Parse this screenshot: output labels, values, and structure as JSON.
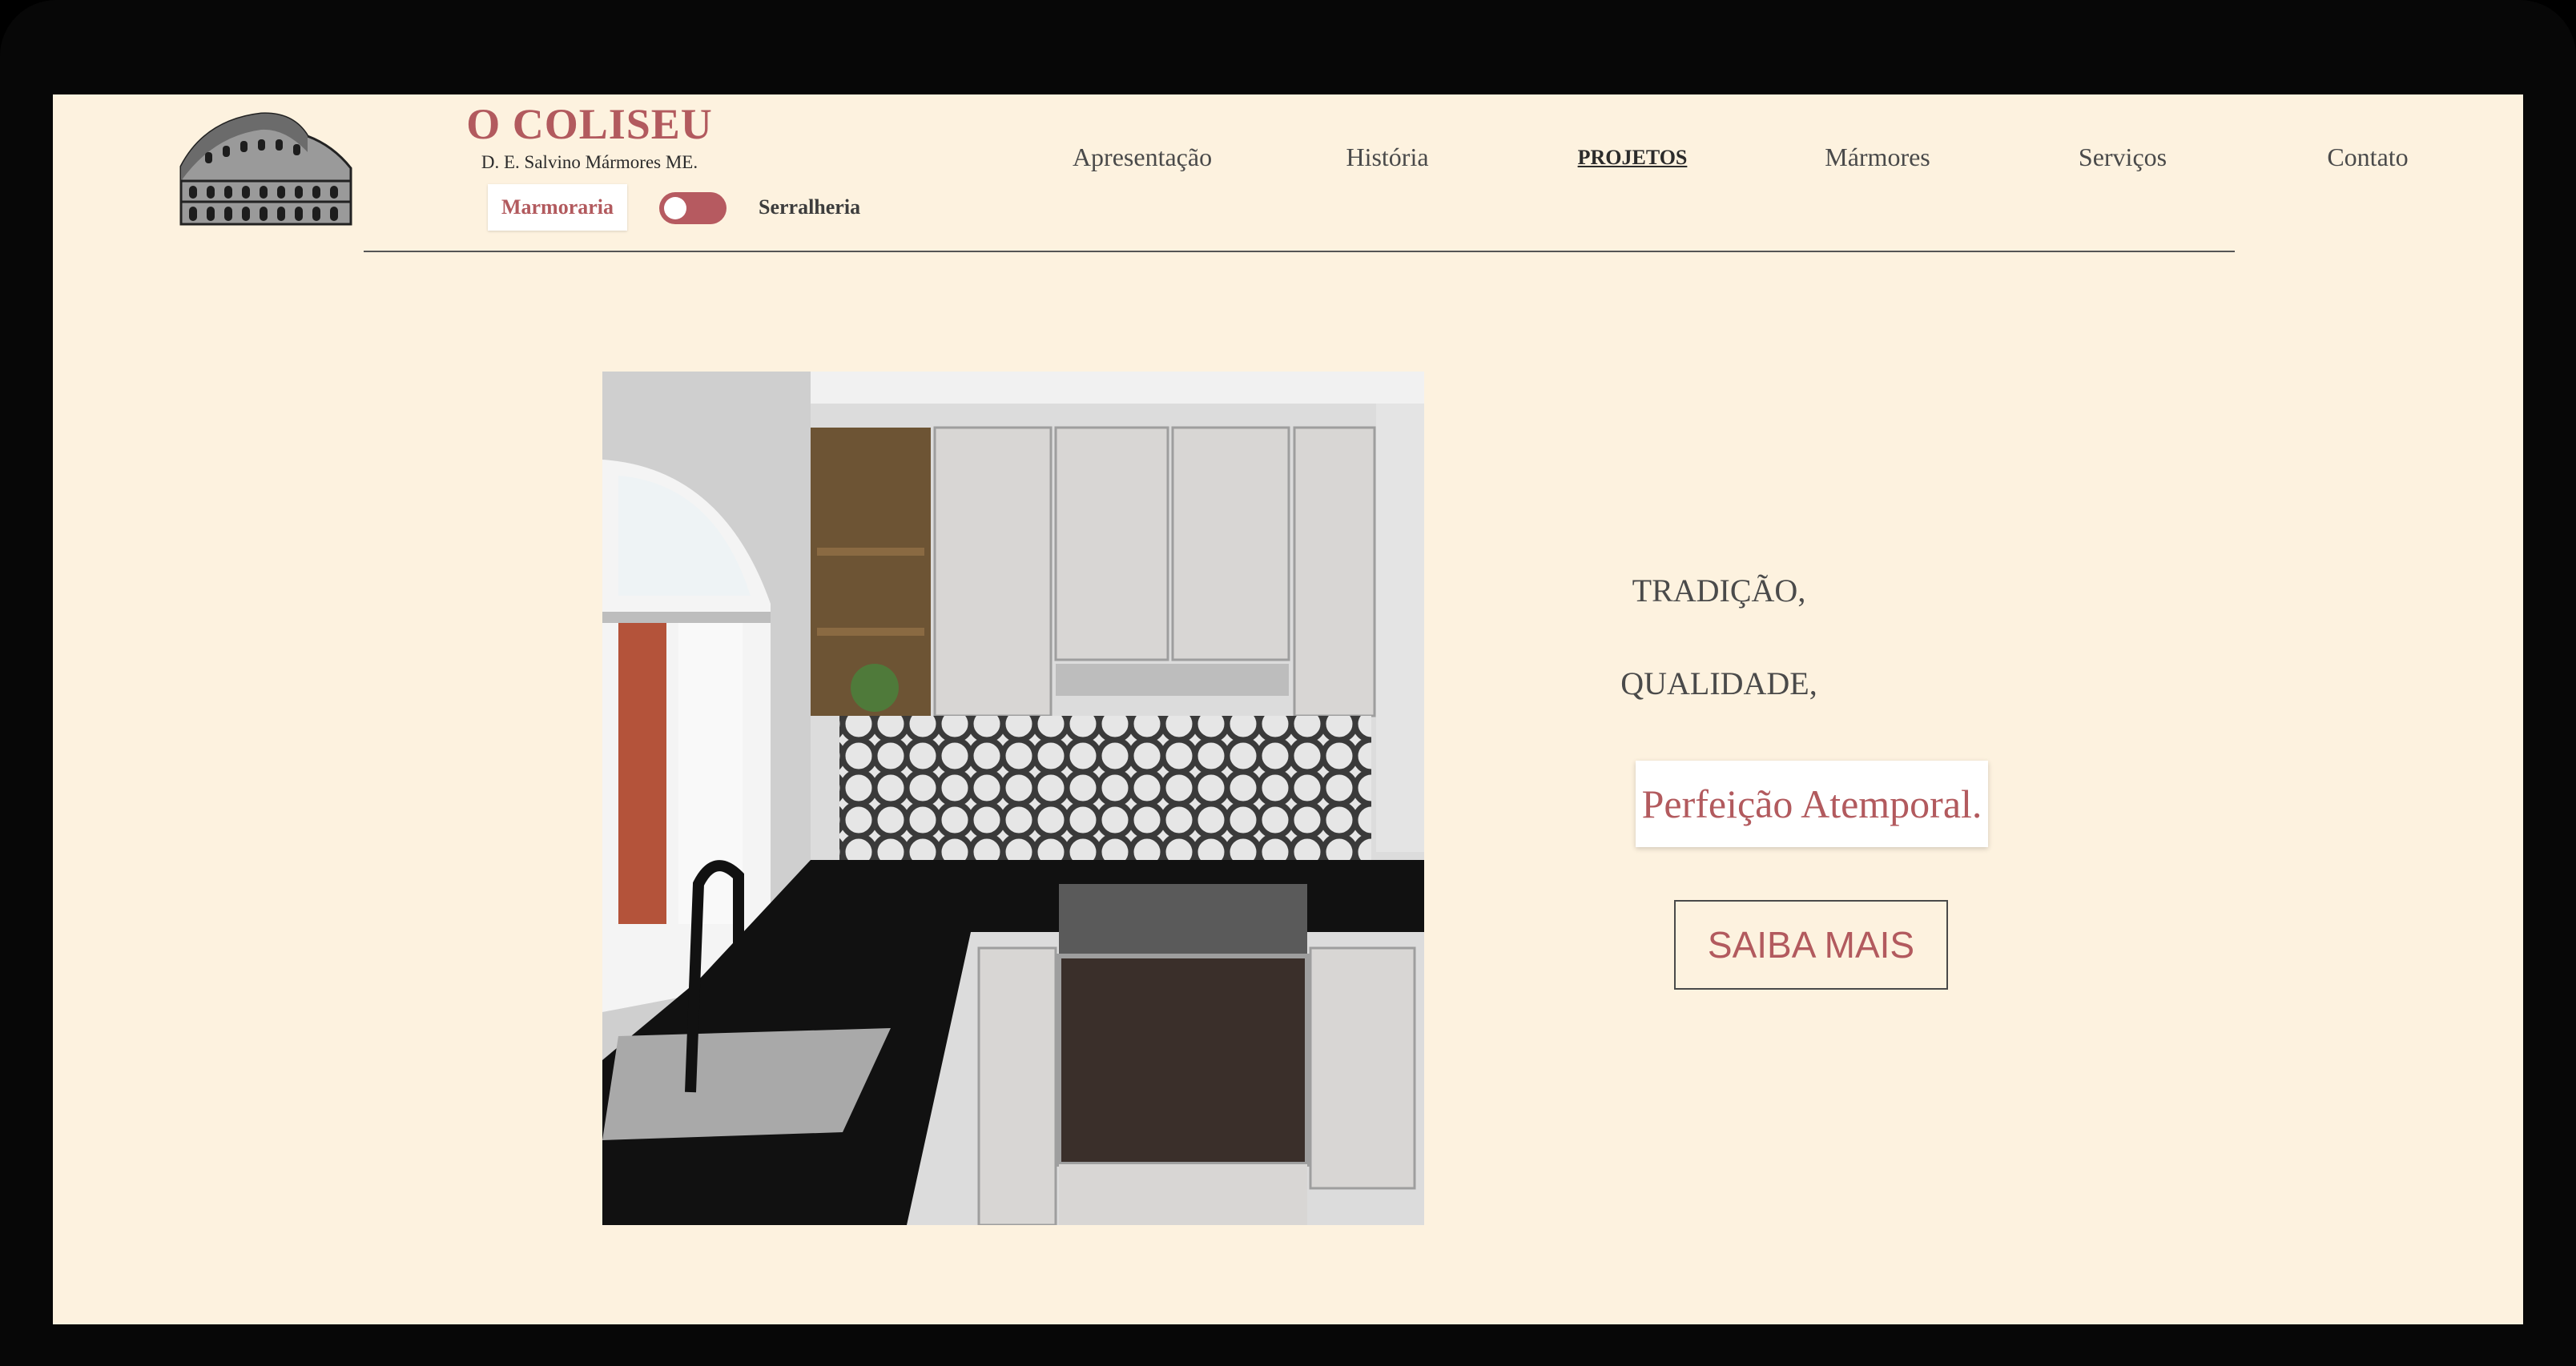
{
  "brand": {
    "title": "O COLISEU",
    "subtitle": "D. E. Salvino Mármores ME.",
    "logo_icon": "colosseum-icon"
  },
  "mode_toggle": {
    "left_label": "Marmoraria",
    "right_label": "Serralheria",
    "state": "Marmoraria"
  },
  "nav": {
    "items": [
      {
        "label": "Apresentação",
        "active": false
      },
      {
        "label": "História",
        "active": false
      },
      {
        "label": "PROJETOS",
        "active": true
      },
      {
        "label": "Mármores",
        "active": false
      },
      {
        "label": "Serviços",
        "active": false
      },
      {
        "label": "Contato",
        "active": false
      }
    ]
  },
  "hero": {
    "image_icon": "kitchen-photo",
    "line1": "TRADIÇÃO,",
    "line2": "QUALIDADE,",
    "accent": "Perfeição Atemporal.",
    "cta_label": "SAIBA MAIS"
  },
  "colors": {
    "background": "#fdf2df",
    "accent": "#b25a5e",
    "text": "#4a4a4a"
  }
}
